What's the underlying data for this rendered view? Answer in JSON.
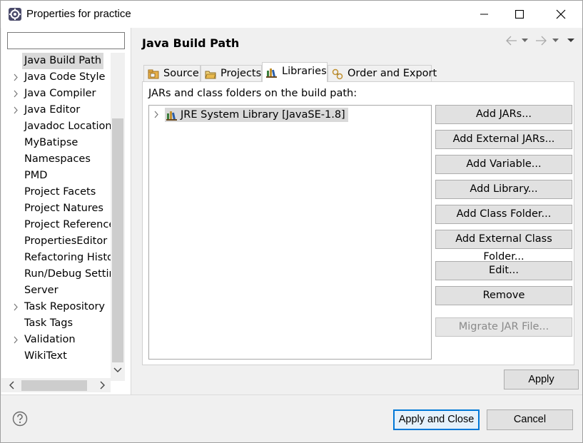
{
  "window": {
    "title": "Properties for practice"
  },
  "filter": {
    "value": "",
    "placeholder": ""
  },
  "tree": {
    "items": [
      {
        "label": "Java Build Path",
        "expandable": false,
        "selected": true
      },
      {
        "label": "Java Code Style",
        "expandable": true
      },
      {
        "label": "Java Compiler",
        "expandable": true
      },
      {
        "label": "Java Editor",
        "expandable": true
      },
      {
        "label": "Javadoc Location",
        "expandable": false
      },
      {
        "label": "MyBatipse",
        "expandable": false
      },
      {
        "label": "Namespaces",
        "expandable": false
      },
      {
        "label": "PMD",
        "expandable": false
      },
      {
        "label": "Project Facets",
        "expandable": false
      },
      {
        "label": "Project Natures",
        "expandable": false
      },
      {
        "label": "Project References",
        "expandable": false
      },
      {
        "label": "PropertiesEditor",
        "expandable": false
      },
      {
        "label": "Refactoring History",
        "expandable": false
      },
      {
        "label": "Run/Debug Settings",
        "expandable": false
      },
      {
        "label": "Server",
        "expandable": false
      },
      {
        "label": "Task Repository",
        "expandable": true
      },
      {
        "label": "Task Tags",
        "expandable": false
      },
      {
        "label": "Validation",
        "expandable": true
      },
      {
        "label": "WikiText",
        "expandable": false
      }
    ]
  },
  "page": {
    "title": "Java Build Path"
  },
  "tabs": [
    {
      "label": "Source",
      "icon": "source-folder-icon"
    },
    {
      "label": "Projects",
      "icon": "projects-icon"
    },
    {
      "label": "Libraries",
      "icon": "libraries-icon",
      "active": true
    },
    {
      "label": "Order and Export",
      "icon": "order-export-icon"
    }
  ],
  "libraries": {
    "caption": "JARs and class folders on the build path:",
    "entries": [
      {
        "label": "JRE System Library [JavaSE-1.8]",
        "icon": "library-icon"
      }
    ],
    "buttons": {
      "add_jars": "Add JARs...",
      "add_external_jars": "Add External JARs...",
      "add_variable": "Add Variable...",
      "add_library": "Add Library...",
      "add_class_folder": "Add Class Folder...",
      "add_external_class_folder": "Add External Class Folder...",
      "edit": "Edit...",
      "remove": "Remove",
      "migrate_jar": "Migrate JAR File..."
    }
  },
  "footer": {
    "apply": "Apply",
    "apply_and_close": "Apply and Close",
    "cancel": "Cancel"
  },
  "colors": {
    "selection": "#d9d9d9",
    "default_button_border": "#0078d7",
    "disabled_text": "#8a8a8a"
  }
}
